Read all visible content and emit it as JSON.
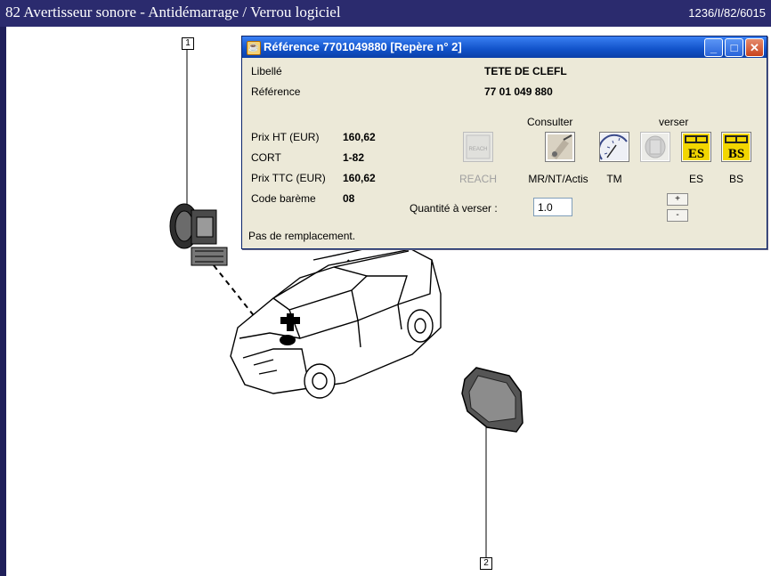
{
  "header": {
    "title": "82 Avertisseur sonore - Antidémarrage / Verrou logiciel",
    "doc_ref": "1236/I/82/6015"
  },
  "diagram": {
    "callouts": [
      "1",
      "2"
    ]
  },
  "dialog": {
    "title": "Référence 7701049880 [Repère n° 2]",
    "fields": {
      "libelle_label": "Libellé",
      "libelle_value": "TETE DE CLEFL",
      "reference_label": "Référence",
      "reference_value": "77 01 049 880",
      "prix_ht_label": "Prix HT (EUR)",
      "prix_ht_value": "160,62",
      "cort_label": "CORT",
      "cort_value": "1-82",
      "prix_ttc_label": "Prix TTC (EUR)",
      "prix_ttc_value": "160,62",
      "code_bareme_label": "Code barème",
      "code_bareme_value": "08"
    },
    "sections": {
      "consulter": "Consulter",
      "verser": "verser"
    },
    "icons": {
      "reach": "REACH",
      "reach_inner": "REACH",
      "mr": "MR/NT/Actis",
      "tm": "TM",
      "es": "ES",
      "bs": "BS"
    },
    "quantity": {
      "label": "Quantité à verser :",
      "value": "1.0",
      "plus": "+",
      "minus": "-"
    },
    "status": "Pas de remplacement."
  },
  "colors": {
    "header_bg": "#2b2b6e",
    "dialog_bg": "#ece9d8",
    "titlebar_blue": "#1152c9"
  }
}
